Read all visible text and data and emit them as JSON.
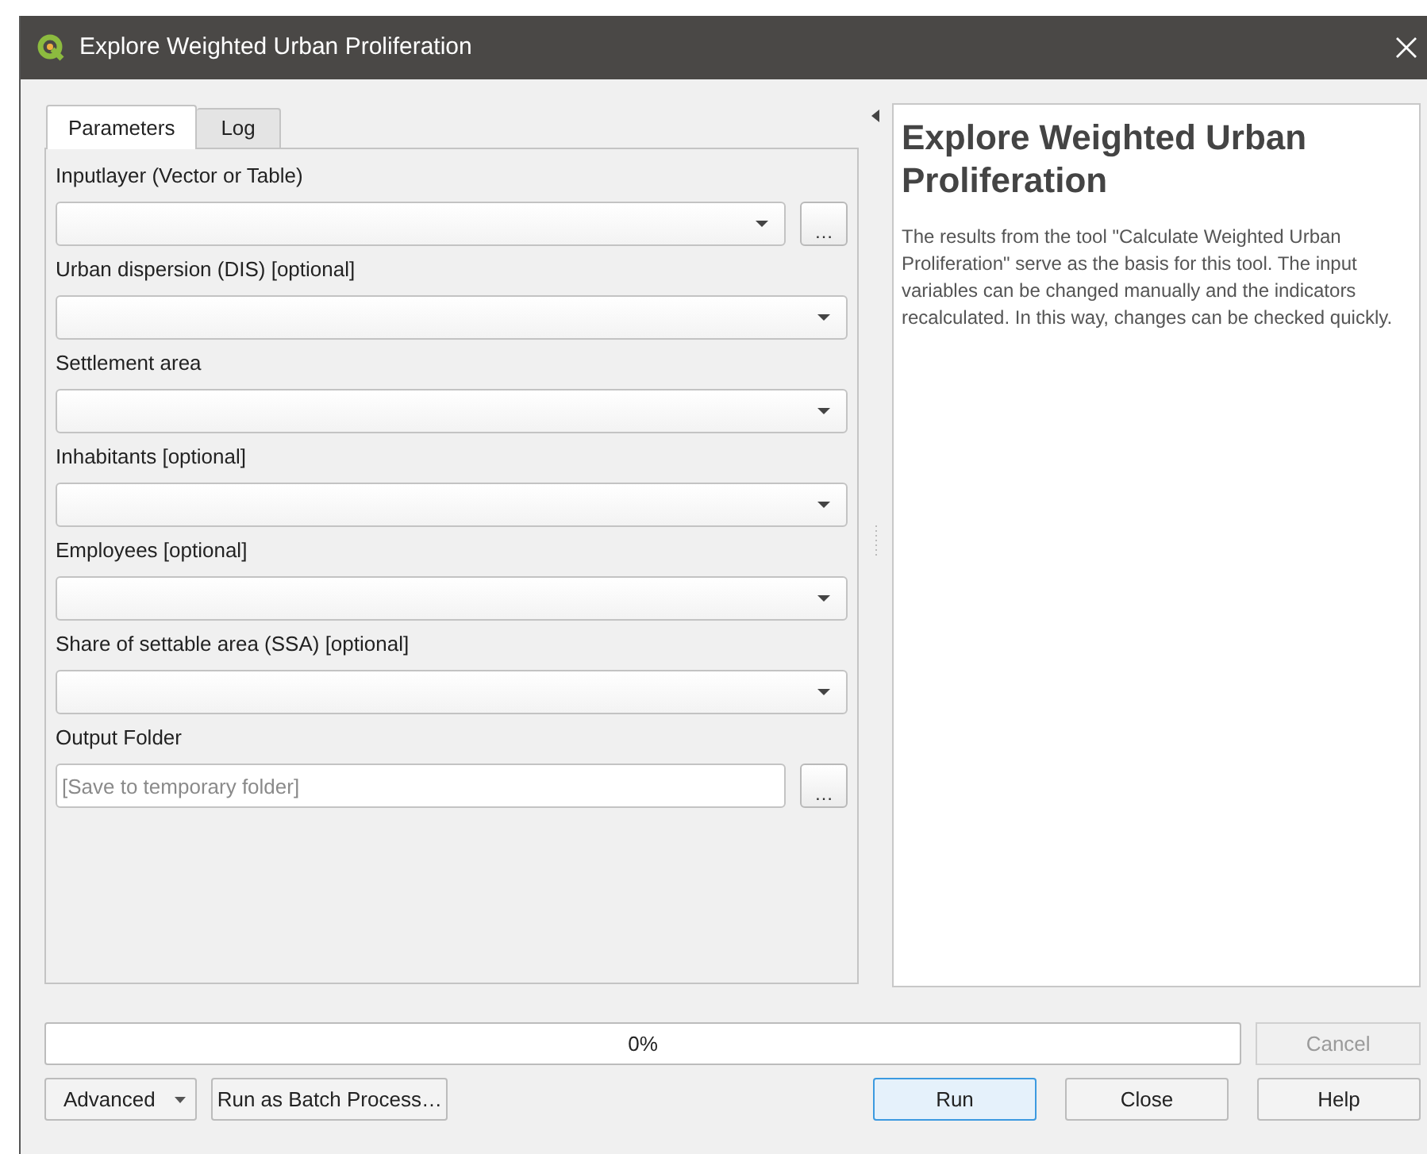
{
  "window": {
    "title": "Explore Weighted Urban Proliferation"
  },
  "tabs": [
    {
      "label": "Parameters",
      "selected": true
    },
    {
      "label": "Log",
      "selected": false
    }
  ],
  "parameters": [
    {
      "label": "Inputlayer (Vector or Table)",
      "kind": "combo_browse",
      "browse": "…"
    },
    {
      "label": "Urban dispersion (DIS) [optional]",
      "kind": "combo"
    },
    {
      "label": "Settlement area",
      "kind": "combo"
    },
    {
      "label": "Inhabitants [optional]",
      "kind": "combo"
    },
    {
      "label": "Employees [optional]",
      "kind": "combo"
    },
    {
      "label": "Share of settable area (SSA) [optional]",
      "kind": "combo"
    },
    {
      "label": "Output Folder",
      "kind": "file",
      "placeholder": "[Save to temporary folder]",
      "browse": "…"
    }
  ],
  "help": {
    "title": "Explore Weighted Urban Proliferation",
    "text": "The results from the tool \"Calculate Weighted Urban Proliferation\" serve as the basis for this tool. The input variables can be changed manually and the indicators recalculated. In this way, changes can be checked quickly."
  },
  "progress": {
    "level": 0,
    "reading": "0%"
  },
  "cancel": {
    "label": "Cancel",
    "disabled": true
  },
  "left_buttons": [
    {
      "label": "Advanced",
      "kind": "menu"
    },
    {
      "label": "Run as Batch Process…",
      "kind": "plain"
    }
  ],
  "right_buttons": [
    {
      "label": "Run",
      "default": true
    },
    {
      "label": "Close",
      "default": false
    },
    {
      "label": "Help",
      "default": false
    }
  ]
}
